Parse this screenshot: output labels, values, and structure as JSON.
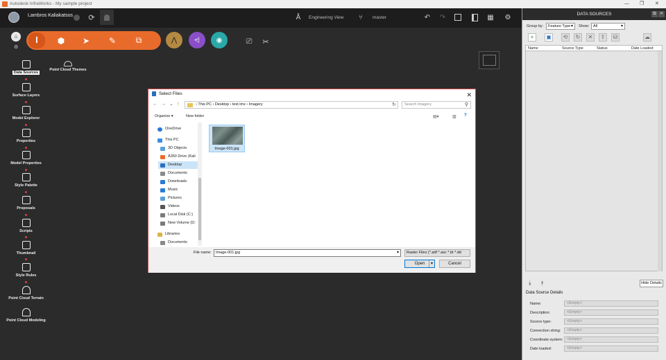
{
  "window": {
    "title": "Autodesk InfraWorks - My sample project",
    "controls": [
      "—",
      "❐",
      "✕"
    ]
  },
  "topbar": {
    "user_name": "Lambros Kaliakatsos",
    "view_mode": "Engineering View",
    "branch": "master"
  },
  "left_nav": {
    "items": [
      {
        "label": "Data Sources",
        "icon": "database-icon"
      },
      {
        "label": "Surface Layers",
        "icon": "layers-icon"
      },
      {
        "label": "Model Explorer",
        "icon": "explorer-icon"
      },
      {
        "label": "Properties",
        "icon": "properties-icon"
      },
      {
        "label": "Model Properties",
        "icon": "model-properties-icon"
      },
      {
        "label": "Style Palette",
        "icon": "palette-icon"
      },
      {
        "label": "Proposals",
        "icon": "proposals-icon"
      },
      {
        "label": "Scripts",
        "icon": "scripts-icon"
      },
      {
        "label": "Thumbnail",
        "icon": "thumbnail-icon"
      },
      {
        "label": "Style Rules",
        "icon": "style-rules-icon"
      },
      {
        "label": "Point Cloud Terrain",
        "icon": "point-cloud-terrain-icon"
      },
      {
        "label": "Point Cloud Modeling",
        "icon": "point-cloud-modeling-icon"
      }
    ],
    "sub_item": "Point Cloud Themes"
  },
  "data_sources": {
    "title": "DATA SOURCES",
    "group_by_label": "Group by:",
    "group_by_value": "Feature Type",
    "show_label": "Show:",
    "show_value": "All",
    "columns": [
      "Name",
      "Source Type",
      "Status",
      "Date Loaded"
    ],
    "hide_details": "Hide Details",
    "details_title": "Data Source Details",
    "details": [
      {
        "label": "Name:",
        "value": "<Empty>"
      },
      {
        "label": "Description:",
        "value": "<Empty>"
      },
      {
        "label": "Source type:",
        "value": "<Empty>"
      },
      {
        "label": "Connection string:",
        "value": "<Empty>"
      },
      {
        "label": "Coordinate system:",
        "value": "<Empty>"
      },
      {
        "label": "Date loaded:",
        "value": "<Empty>"
      }
    ]
  },
  "dialog": {
    "title": "Select Files",
    "path": [
      "This PC",
      "Desktop",
      "test imx",
      "Imagery"
    ],
    "search_placeholder": "Search Imagery",
    "organize": "Organize ▾",
    "new_folder": "New folder",
    "tree": [
      {
        "label": "OneDrive",
        "color": "#2a7ad6"
      },
      {
        "label": "This PC",
        "color": "#3a8ee6"
      },
      {
        "label": "3D Objects",
        "color": "#5aa0d8"
      },
      {
        "label": "A360 Drive (Kali",
        "color": "#e96b2b"
      },
      {
        "label": "Desktop",
        "color": "#2a6fbf",
        "selected": true
      },
      {
        "label": "Documents",
        "color": "#8a8a8a"
      },
      {
        "label": "Downloads",
        "color": "#2a7ad6"
      },
      {
        "label": "Music",
        "color": "#2a7ad6"
      },
      {
        "label": "Pictures",
        "color": "#5aa0d8"
      },
      {
        "label": "Videos",
        "color": "#555555"
      },
      {
        "label": "Local Disk (C:)",
        "color": "#7a7a7a"
      },
      {
        "label": "New Volume (D:",
        "color": "#7a7a7a"
      },
      {
        "label": "Libraries",
        "color": "#d8b44a"
      },
      {
        "label": "Documents",
        "color": "#8a8a8a"
      }
    ],
    "file": {
      "name": "Image-001.jpg"
    },
    "file_name_label": "File name:",
    "file_name_value": "Image-001.jpg",
    "filter": "Raster Files (*.adf *.asc *.bt *.dd",
    "open": "Open",
    "cancel": "Cancel"
  }
}
